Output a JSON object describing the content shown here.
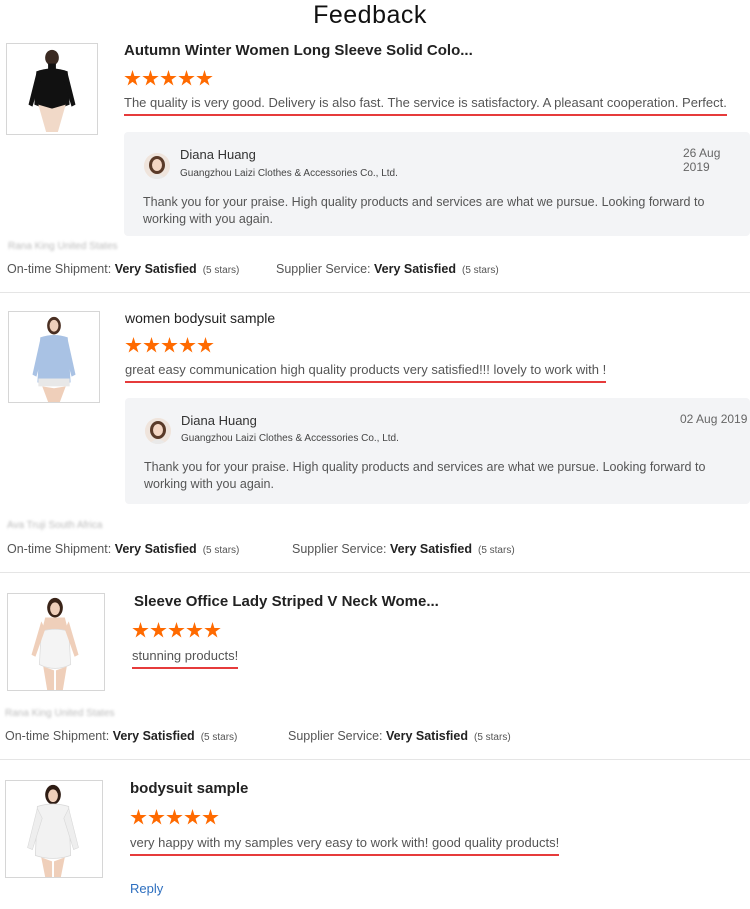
{
  "page": {
    "title": "Feedback"
  },
  "reviews": [
    {
      "product_title": "Autumn Winter Women Long Sleeve Solid Colo...",
      "rating_stars": 5,
      "text": "The quality is very good. Delivery is also fast. The service is satisfactory. A pleasant cooperation. Perfect.",
      "reply": {
        "name": "Diana Huang",
        "company": "Guangzhou Laizi Clothes & Accessories Co., Ltd.",
        "date": "26 Aug 2019",
        "text_line1": "Thank you for your praise. High quality products and services are what we pursue. Looking forward to",
        "text_line2": "working with you again."
      },
      "buyer": "Rana King United States",
      "shipment_label": "On-time Shipment:",
      "shipment_value": "Very Satisfied",
      "shipment_stars": "(5 stars)",
      "service_label": "Supplier Service:",
      "service_value": "Very Satisfied",
      "service_stars": "(5 stars)"
    },
    {
      "product_title": "women bodysuit sample",
      "rating_stars": 5,
      "text": "great easy communication high quality products very satisfied!!! lovely to work with !",
      "reply": {
        "name": "Diana Huang",
        "company": "Guangzhou Laizi Clothes & Accessories Co., Ltd.",
        "date": "02 Aug 2019",
        "text_line1": "Thank you for your praise. High quality products and services are what we pursue. Looking forward to",
        "text_line2": "working with you again."
      },
      "buyer": "Ava Truji South Africa",
      "shipment_label": "On-time Shipment:",
      "shipment_value": "Very Satisfied",
      "shipment_stars": "(5 stars)",
      "service_label": "Supplier Service:",
      "service_value": "Very Satisfied",
      "service_stars": "(5 stars)"
    },
    {
      "product_title": "Sleeve Office Lady Striped V Neck Wome...",
      "rating_stars": 5,
      "text": "stunning products!",
      "buyer": "Rana King United States",
      "shipment_label": "On-time Shipment:",
      "shipment_value": "Very Satisfied",
      "shipment_stars": "(5 stars)",
      "service_label": "Supplier Service:",
      "service_value": "Very Satisfied",
      "service_stars": "(5 stars)"
    },
    {
      "product_title": "bodysuit sample",
      "rating_stars": 5,
      "text": "very happy with my samples very easy to work with! good quality products!",
      "reply_link": "Reply"
    }
  ],
  "colors": {
    "star": "#ff6a00",
    "underline": "#e63b3b",
    "link": "#2e6fbf",
    "reply_bg": "#f3f4f6"
  }
}
